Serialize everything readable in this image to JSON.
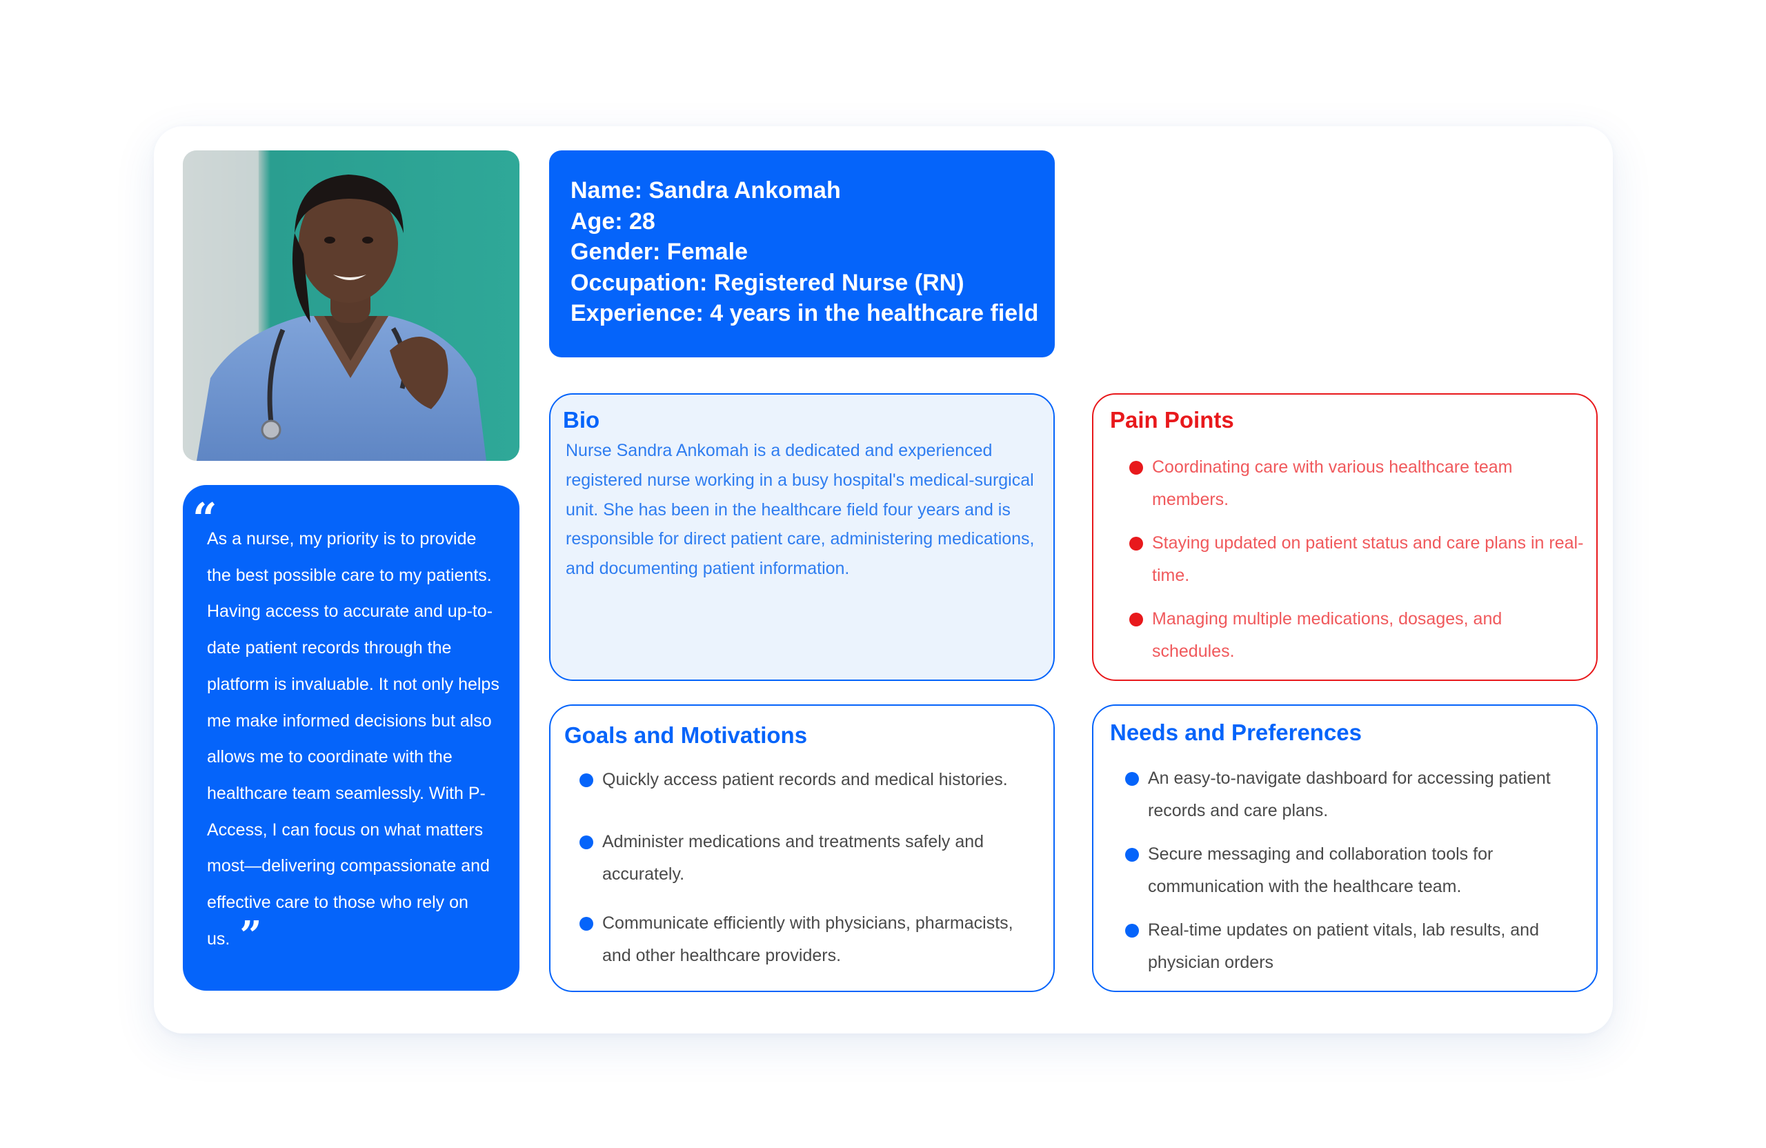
{
  "profile": {
    "name": "Name: Sandra Ankomah",
    "age": "Age: 28",
    "gender": "Gender: Female",
    "occupation": "Occupation: Registered Nurse (RN)",
    "experience": "Experience: 4 years in the healthcare field"
  },
  "quote": {
    "open_mark": "“",
    "close_mark": "”",
    "text": "As a nurse, my priority is to provide the best possible care to my patients. Having access to accurate and up-to-date patient records through the platform is invaluable. It not only helps me make informed decisions but also allows me to coordinate with the healthcare team seamlessly. With P-Access, I can focus on what matters most—delivering compassionate and effective care to those who rely on us."
  },
  "bio": {
    "title": "Bio",
    "text": "Nurse Sandra Ankomah is a dedicated and experienced registered nurse working in a busy hospital's medical-surgical unit. She has been in the healthcare field four years and is responsible for direct patient care, administering medications, and documenting patient information."
  },
  "pain_points": {
    "title": "Pain Points",
    "items": [
      "Coordinating care with various healthcare team members.",
      "Staying updated on patient status and care plans in real-time.",
      "Managing multiple medications, dosages, and schedules."
    ]
  },
  "goals": {
    "title": "Goals and Motivations",
    "items": [
      "Quickly access patient records and medical histories.",
      "Administer medications and treatments safely and accurately.",
      "Communicate efficiently with physicians, pharmacists, and other healthcare providers."
    ]
  },
  "needs": {
    "title": "Needs and Preferences",
    "items": [
      "An easy-to-navigate dashboard for accessing patient records and care plans.",
      "Secure messaging and collaboration tools for communication with the healthcare team.",
      "Real-time updates on patient vitals, lab results, and physician orders"
    ]
  },
  "colors": {
    "accent_blue": "#0564fa",
    "pain_red": "#e8191c",
    "bio_bg": "#ebf3fd"
  },
  "icons": {
    "quote_open": "quote-open-icon",
    "quote_close": "quote-close-icon",
    "bullet": "bullet-dot-icon"
  }
}
